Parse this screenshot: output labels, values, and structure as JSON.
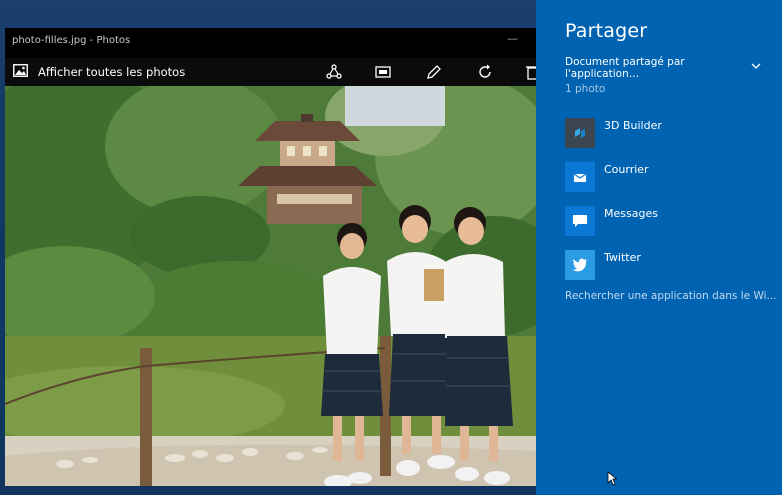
{
  "window": {
    "title": "photo-filles.jpg - Photos",
    "minimize_glyph": "—"
  },
  "toolbar": {
    "all_photos_label": "Afficher toutes les photos",
    "icons": [
      "photos-icon",
      "share-icon",
      "slideshow-icon",
      "edit-pen-icon",
      "rotate-icon",
      "delete-icon"
    ]
  },
  "share": {
    "title": "Partager",
    "dropdown_label": "Document partagé par l'application…",
    "count_label": "1 photo",
    "apps": [
      {
        "label": "3D Builder",
        "icon": "3d-builder-icon",
        "tile_color": "#3c4651"
      },
      {
        "label": "Courrier",
        "icon": "mail-icon",
        "tile_color": "#0b78d6"
      },
      {
        "label": "Messages",
        "icon": "messages-icon",
        "tile_color": "#0b78d6"
      },
      {
        "label": "Twitter",
        "icon": "twitter-icon",
        "tile_color": "#2b9be3"
      }
    ],
    "search_label": "Rechercher une application dans le Wi..."
  },
  "colors": {
    "share_pane_bg": "#0063b1",
    "desktop_bg": "#123a66",
    "window_bg": "#000000"
  }
}
